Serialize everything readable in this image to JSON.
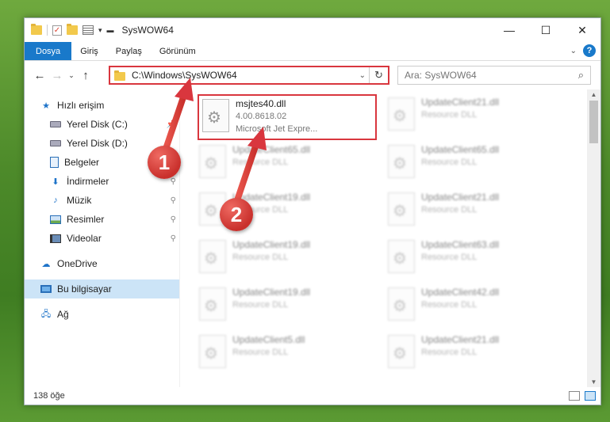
{
  "window": {
    "title": "SysWOW64"
  },
  "ribbon": {
    "tabs": [
      "Dosya",
      "Giriş",
      "Paylaş",
      "Görünüm"
    ],
    "help": "?"
  },
  "address": {
    "path": "C:\\Windows\\SysWOW64"
  },
  "search": {
    "placeholder": "Ara: SysWOW64"
  },
  "sidebar": {
    "items": [
      {
        "label": "Hızlı erişim"
      },
      {
        "label": "Yerel Disk (C:)"
      },
      {
        "label": "Yerel Disk (D:)"
      },
      {
        "label": "Belgeler"
      },
      {
        "label": "İndirmeler"
      },
      {
        "label": "Müzik"
      },
      {
        "label": "Resimler"
      },
      {
        "label": "Videolar"
      },
      {
        "label": "OneDrive"
      },
      {
        "label": "Bu bilgisayar"
      },
      {
        "label": "Ağ"
      }
    ]
  },
  "files": [
    {
      "name": "msjtes40.dll",
      "line2": "4.00.8618.02",
      "line3": "Microsoft Jet Expre..."
    },
    {
      "name": "UpdateClient21.dll",
      "line2": "Resource DLL"
    },
    {
      "name": "UpdateClient65.dll",
      "line2": "Resource DLL"
    },
    {
      "name": "UpdateClient65.dll",
      "line2": "Resource DLL"
    },
    {
      "name": "UpdateClient19.dll",
      "line2": "Resource DLL"
    },
    {
      "name": "UpdateClient21.dll",
      "line2": "Resource DLL"
    },
    {
      "name": "UpdateClient19.dll",
      "line2": "Resource DLL"
    },
    {
      "name": "UpdateClient63.dll",
      "line2": "Resource DLL"
    },
    {
      "name": "UpdateClient19.dll",
      "line2": "Resource DLL"
    },
    {
      "name": "UpdateClient42.dll",
      "line2": "Resource DLL"
    },
    {
      "name": "UpdateClient5.dll",
      "line2": "Resource DLL"
    },
    {
      "name": "UpdateClient21.dll",
      "line2": "Resource DLL"
    }
  ],
  "status": {
    "count": "138 öğe"
  },
  "callouts": {
    "one": "1",
    "two": "2"
  },
  "colors": {
    "accent": "#1979ca",
    "highlight": "#d9363e"
  }
}
